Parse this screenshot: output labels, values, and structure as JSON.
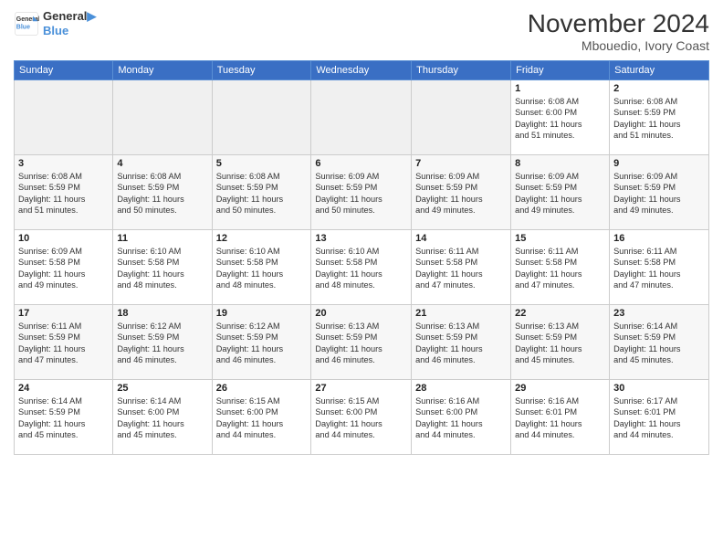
{
  "header": {
    "logo_line1": "General",
    "logo_line2": "Blue",
    "month_title": "November 2024",
    "location": "Mbouedio, Ivory Coast"
  },
  "weekdays": [
    "Sunday",
    "Monday",
    "Tuesday",
    "Wednesday",
    "Thursday",
    "Friday",
    "Saturday"
  ],
  "weeks": [
    [
      {
        "day": "",
        "info": ""
      },
      {
        "day": "",
        "info": ""
      },
      {
        "day": "",
        "info": ""
      },
      {
        "day": "",
        "info": ""
      },
      {
        "day": "",
        "info": ""
      },
      {
        "day": "1",
        "info": "Sunrise: 6:08 AM\nSunset: 6:00 PM\nDaylight: 11 hours\nand 51 minutes."
      },
      {
        "day": "2",
        "info": "Sunrise: 6:08 AM\nSunset: 5:59 PM\nDaylight: 11 hours\nand 51 minutes."
      }
    ],
    [
      {
        "day": "3",
        "info": "Sunrise: 6:08 AM\nSunset: 5:59 PM\nDaylight: 11 hours\nand 51 minutes."
      },
      {
        "day": "4",
        "info": "Sunrise: 6:08 AM\nSunset: 5:59 PM\nDaylight: 11 hours\nand 50 minutes."
      },
      {
        "day": "5",
        "info": "Sunrise: 6:08 AM\nSunset: 5:59 PM\nDaylight: 11 hours\nand 50 minutes."
      },
      {
        "day": "6",
        "info": "Sunrise: 6:09 AM\nSunset: 5:59 PM\nDaylight: 11 hours\nand 50 minutes."
      },
      {
        "day": "7",
        "info": "Sunrise: 6:09 AM\nSunset: 5:59 PM\nDaylight: 11 hours\nand 49 minutes."
      },
      {
        "day": "8",
        "info": "Sunrise: 6:09 AM\nSunset: 5:59 PM\nDaylight: 11 hours\nand 49 minutes."
      },
      {
        "day": "9",
        "info": "Sunrise: 6:09 AM\nSunset: 5:59 PM\nDaylight: 11 hours\nand 49 minutes."
      }
    ],
    [
      {
        "day": "10",
        "info": "Sunrise: 6:09 AM\nSunset: 5:58 PM\nDaylight: 11 hours\nand 49 minutes."
      },
      {
        "day": "11",
        "info": "Sunrise: 6:10 AM\nSunset: 5:58 PM\nDaylight: 11 hours\nand 48 minutes."
      },
      {
        "day": "12",
        "info": "Sunrise: 6:10 AM\nSunset: 5:58 PM\nDaylight: 11 hours\nand 48 minutes."
      },
      {
        "day": "13",
        "info": "Sunrise: 6:10 AM\nSunset: 5:58 PM\nDaylight: 11 hours\nand 48 minutes."
      },
      {
        "day": "14",
        "info": "Sunrise: 6:11 AM\nSunset: 5:58 PM\nDaylight: 11 hours\nand 47 minutes."
      },
      {
        "day": "15",
        "info": "Sunrise: 6:11 AM\nSunset: 5:58 PM\nDaylight: 11 hours\nand 47 minutes."
      },
      {
        "day": "16",
        "info": "Sunrise: 6:11 AM\nSunset: 5:58 PM\nDaylight: 11 hours\nand 47 minutes."
      }
    ],
    [
      {
        "day": "17",
        "info": "Sunrise: 6:11 AM\nSunset: 5:59 PM\nDaylight: 11 hours\nand 47 minutes."
      },
      {
        "day": "18",
        "info": "Sunrise: 6:12 AM\nSunset: 5:59 PM\nDaylight: 11 hours\nand 46 minutes."
      },
      {
        "day": "19",
        "info": "Sunrise: 6:12 AM\nSunset: 5:59 PM\nDaylight: 11 hours\nand 46 minutes."
      },
      {
        "day": "20",
        "info": "Sunrise: 6:13 AM\nSunset: 5:59 PM\nDaylight: 11 hours\nand 46 minutes."
      },
      {
        "day": "21",
        "info": "Sunrise: 6:13 AM\nSunset: 5:59 PM\nDaylight: 11 hours\nand 46 minutes."
      },
      {
        "day": "22",
        "info": "Sunrise: 6:13 AM\nSunset: 5:59 PM\nDaylight: 11 hours\nand 45 minutes."
      },
      {
        "day": "23",
        "info": "Sunrise: 6:14 AM\nSunset: 5:59 PM\nDaylight: 11 hours\nand 45 minutes."
      }
    ],
    [
      {
        "day": "24",
        "info": "Sunrise: 6:14 AM\nSunset: 5:59 PM\nDaylight: 11 hours\nand 45 minutes."
      },
      {
        "day": "25",
        "info": "Sunrise: 6:14 AM\nSunset: 6:00 PM\nDaylight: 11 hours\nand 45 minutes."
      },
      {
        "day": "26",
        "info": "Sunrise: 6:15 AM\nSunset: 6:00 PM\nDaylight: 11 hours\nand 44 minutes."
      },
      {
        "day": "27",
        "info": "Sunrise: 6:15 AM\nSunset: 6:00 PM\nDaylight: 11 hours\nand 44 minutes."
      },
      {
        "day": "28",
        "info": "Sunrise: 6:16 AM\nSunset: 6:00 PM\nDaylight: 11 hours\nand 44 minutes."
      },
      {
        "day": "29",
        "info": "Sunrise: 6:16 AM\nSunset: 6:01 PM\nDaylight: 11 hours\nand 44 minutes."
      },
      {
        "day": "30",
        "info": "Sunrise: 6:17 AM\nSunset: 6:01 PM\nDaylight: 11 hours\nand 44 minutes."
      }
    ]
  ]
}
